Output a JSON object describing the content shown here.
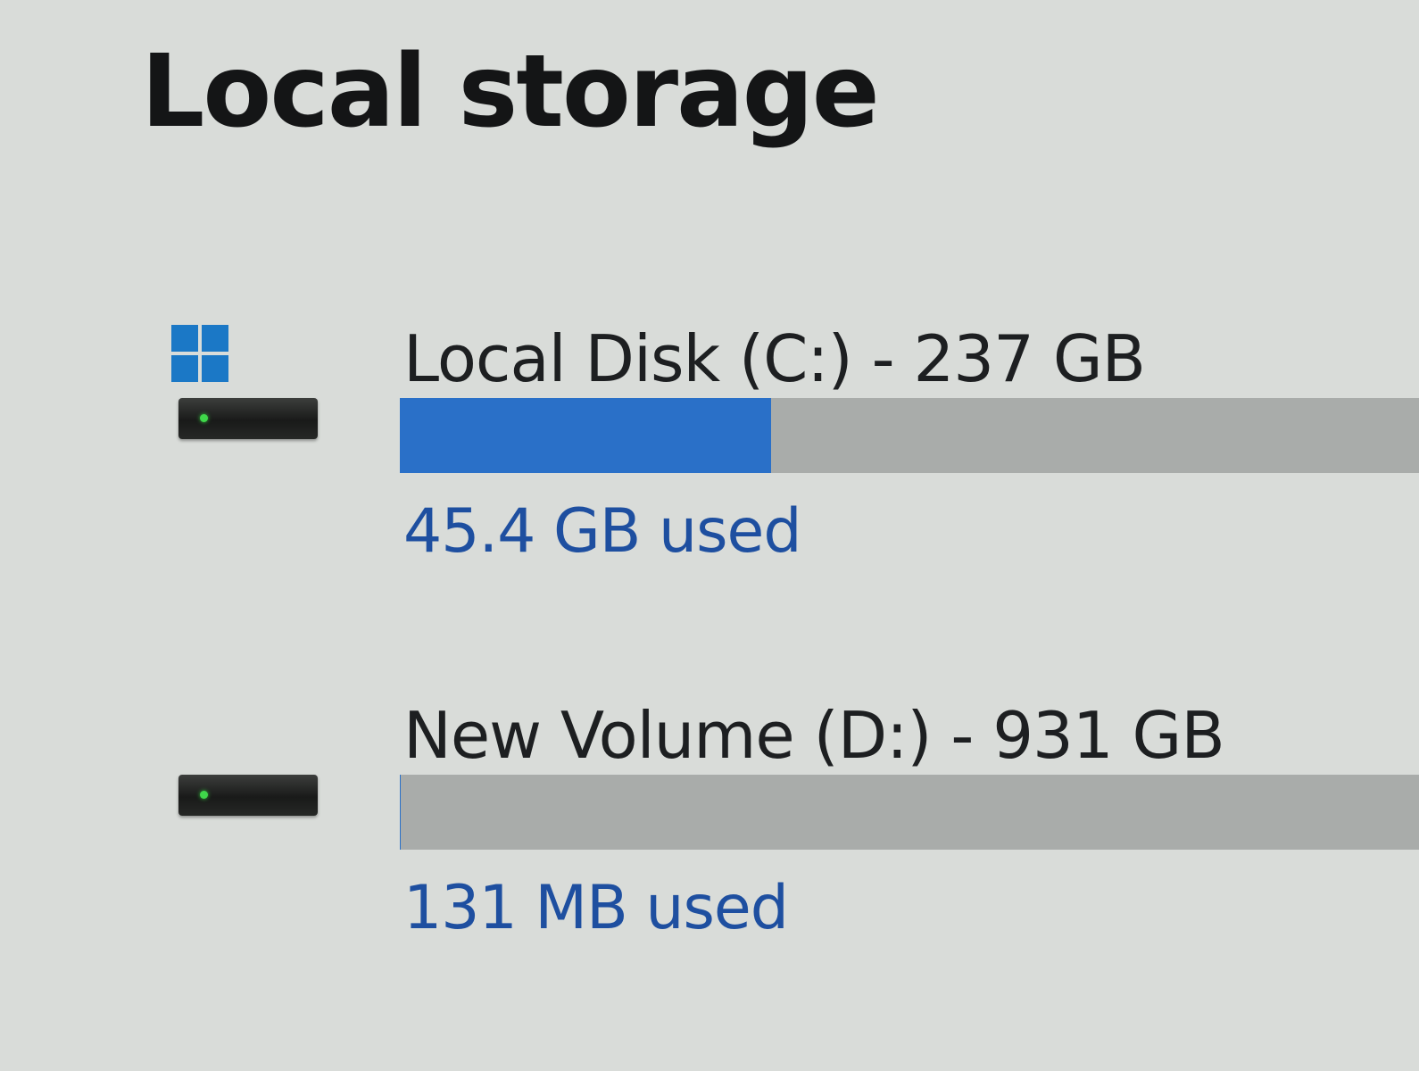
{
  "page": {
    "title": "Local storage"
  },
  "drives": [
    {
      "name": "Local Disk (C:) - 237 GB",
      "used_label": "45.4 GB used",
      "used_fraction": 0.364,
      "icon": "windows-system-drive-icon"
    },
    {
      "name": "New Volume (D:) - 931 GB",
      "used_label": "131 MB used",
      "used_fraction": 0.0001,
      "icon": "hard-drive-icon"
    }
  ],
  "colors": {
    "background": "#d9dcd9",
    "bar_fill": "#2a70c8",
    "bar_track": "#a9acaa",
    "used_text": "#1e4fa0",
    "windows_logo": "#1b78c6",
    "drive_led": "#3fd84a"
  }
}
